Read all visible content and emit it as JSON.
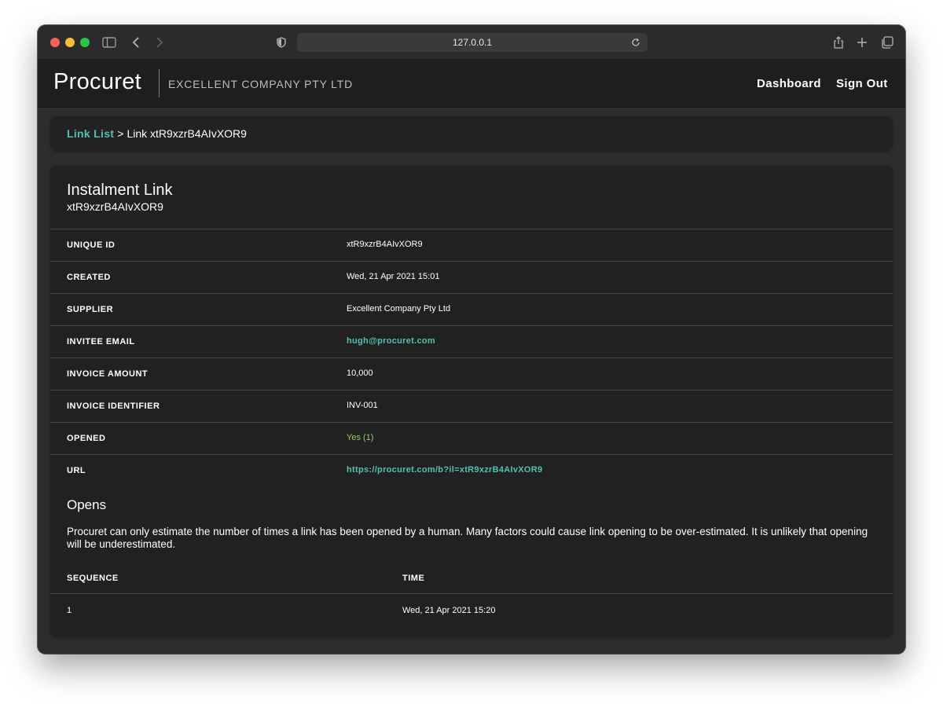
{
  "browser": {
    "url": "127.0.0.1"
  },
  "header": {
    "logo": "Procuret",
    "company": "EXCELLENT COMPANY PTY LTD",
    "nav": {
      "dashboard": "Dashboard",
      "sign_out": "Sign Out"
    }
  },
  "breadcrumb": {
    "link": "Link List",
    "separator": ">",
    "current": "Link xtR9xzrB4AIvXOR9"
  },
  "card": {
    "title": "Instalment Link",
    "subtitle": "xtR9xzrB4AIvXOR9",
    "details": [
      {
        "label": "UNIQUE ID",
        "value": "xtR9xzrB4AIvXOR9"
      },
      {
        "label": "CREATED",
        "value": "Wed, 21 Apr 2021 15:01"
      },
      {
        "label": "SUPPLIER",
        "value": "Excellent Company Pty Ltd"
      },
      {
        "label": "INVITEE EMAIL",
        "value": "hugh@procuret.com"
      },
      {
        "label": "INVOICE AMOUNT",
        "value": "10,000"
      },
      {
        "label": "INVOICE IDENTIFIER",
        "value": "INV-001"
      },
      {
        "label": "OPENED",
        "value": "Yes (1)"
      },
      {
        "label": "URL",
        "value": "https://procuret.com/b?il=xtR9xzrB4AIvXOR9"
      }
    ]
  },
  "opens": {
    "title": "Opens",
    "description": "Procuret can only estimate the number of times a link has been opened by a human. Many factors could cause link opening to be over-estimated. It is unlikely that opening will be underestimated.",
    "columns": [
      "SEQUENCE",
      "TIME"
    ],
    "rows": [
      {
        "sequence": "1",
        "time": "Wed, 21 Apr 2021 15:20"
      }
    ]
  },
  "colors": {
    "accent": "#4fc3ae",
    "opened_green": "#9ccc65",
    "background": "#2d2d2d",
    "card": "#212121"
  },
  "icons": [
    "sidebar-icon",
    "back-icon",
    "forward-icon",
    "shield-icon",
    "reload-icon",
    "share-icon",
    "new-tab-icon",
    "tabs-overview-icon"
  ]
}
